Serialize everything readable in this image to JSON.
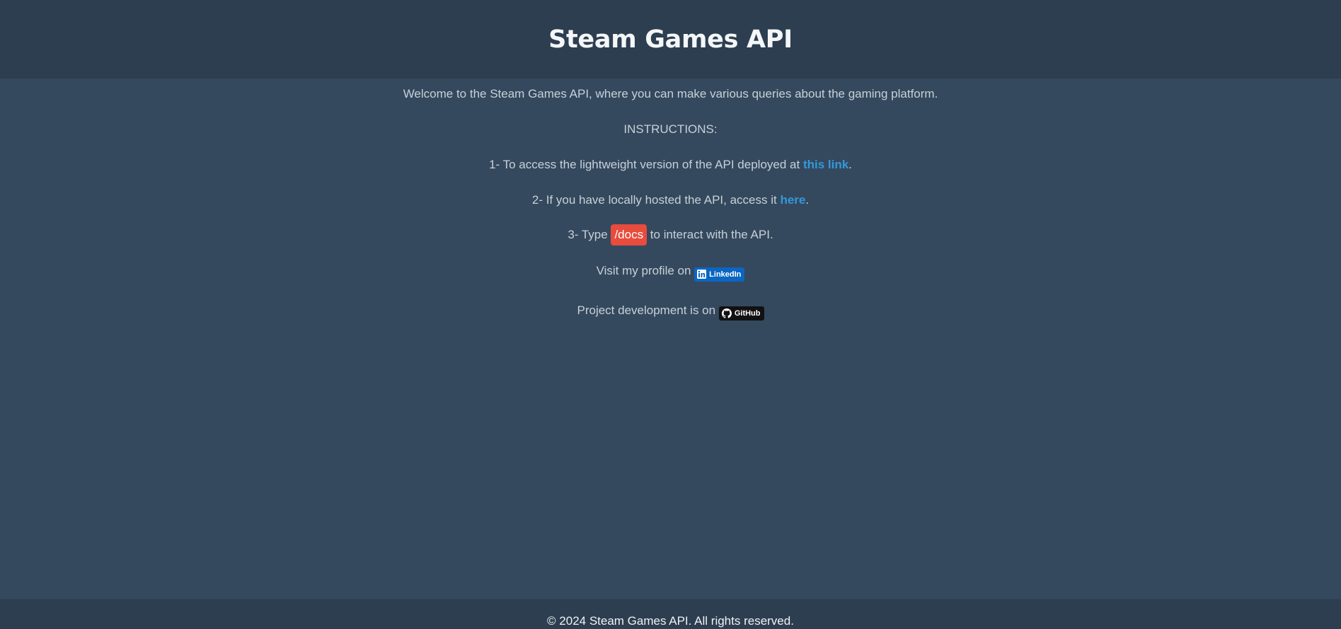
{
  "header": {
    "title": "Steam Games API"
  },
  "main": {
    "welcome": "Welcome to the Steam Games API, where you can make various queries about the gaming platform.",
    "instructions_heading": "INSTRUCTIONS:",
    "step1": {
      "text": "1- To access the lightweight version of the API deployed at ",
      "link_label": "this link",
      "suffix": "."
    },
    "step2": {
      "text": "2- If you have locally hosted the API, access it ",
      "link_label": "here",
      "suffix": "."
    },
    "step3": {
      "prefix": "3- Type ",
      "code": "/docs",
      "suffix": " to interact with the API."
    },
    "profile": {
      "text": "Visit my profile on ",
      "badge_label": "LinkedIn",
      "badge_icon": "linkedin-icon",
      "badge_color": "#0a66c2"
    },
    "project": {
      "text": "Project development is on ",
      "badge_label": "GitHub",
      "badge_icon": "github-icon",
      "badge_color": "#111111"
    }
  },
  "footer": {
    "copyright": "© 2024 Steam Games API. All rights reserved."
  },
  "colors": {
    "header_bg": "#2c3e50",
    "page_bg": "#34495e",
    "link": "#3498db",
    "code_bg": "#e74c3c"
  }
}
